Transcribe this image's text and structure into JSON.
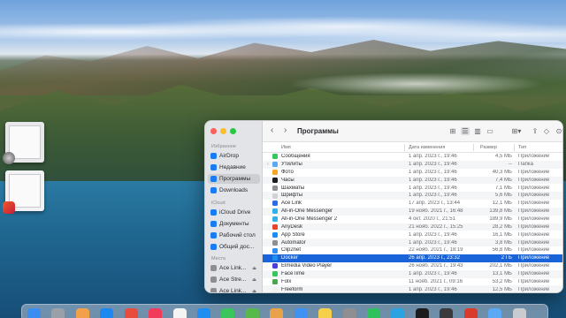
{
  "window": {
    "title": "Программы"
  },
  "sidebar": {
    "favorites_label": "Избранное",
    "favorites": [
      {
        "label": "AirDrop",
        "icon": "airdrop-icon"
      },
      {
        "label": "Недавние",
        "icon": "clock-icon"
      },
      {
        "label": "Программы",
        "icon": "applications-icon",
        "selected": true
      },
      {
        "label": "Downloads",
        "icon": "downloads-icon"
      }
    ],
    "icloud_label": "iCloud",
    "icloud": [
      {
        "label": "iCloud Drive",
        "icon": "cloud-icon"
      },
      {
        "label": "Документы",
        "icon": "document-icon"
      },
      {
        "label": "Рабочий стол",
        "icon": "desktop-icon"
      },
      {
        "label": "Общий дос...",
        "icon": "shared-folder-icon"
      }
    ],
    "locations_label": "Места",
    "locations": [
      {
        "label": "Ace Link...",
        "icon": "disk-icon"
      },
      {
        "label": "Ace Stre...",
        "icon": "disk-icon"
      },
      {
        "label": "Ace Link...",
        "icon": "disk-icon"
      }
    ]
  },
  "columns": {
    "name": "Имя",
    "date": "Дата изменения",
    "size": "Размер",
    "type": "Тип"
  },
  "rows": [
    {
      "name": "Сообщения",
      "date": "1 апр. 2023 г., 19:46",
      "size": "4,5 МБ",
      "type": "Приложение",
      "color": "#34c759"
    },
    {
      "name": "Утилиты",
      "date": "1 апр. 2023 г., 19:46",
      "size": "--",
      "type": "Папка",
      "color": "#5aa9f6",
      "folder": true
    },
    {
      "name": "Фото",
      "date": "1 апр. 2023 г., 19:46",
      "size": "40,3 МБ",
      "type": "Приложение",
      "color": "#f6a623"
    },
    {
      "name": "Часы",
      "date": "1 апр. 2023 г., 19:46",
      "size": "7,4 МБ",
      "type": "Приложение",
      "color": "#1c1c1e"
    },
    {
      "name": "Шахматы",
      "date": "1 апр. 2023 г., 19:46",
      "size": "7,1 МБ",
      "type": "Приложение",
      "color": "#8e8e93"
    },
    {
      "name": "Шрифты",
      "date": "1 апр. 2023 г., 19:46",
      "size": "5,6 МБ",
      "type": "Приложение",
      "color": "#d1d1d6"
    },
    {
      "name": "Ace Link",
      "date": "17 апр. 2023 г., 13:44",
      "size": "12,1 МБ",
      "type": "Приложение",
      "color": "#2b6de8"
    },
    {
      "name": "All-in-One Messenger",
      "date": "19 нояб. 2021 г., 16:48",
      "size": "139,8 МБ",
      "type": "Приложение",
      "color": "#2fb0e8"
    },
    {
      "name": "All-in-One Messenger 2",
      "date": "4 окт. 2020 г., 21:51",
      "size": "189,9 МБ",
      "type": "Приложение",
      "color": "#2fb0e8"
    },
    {
      "name": "AnyDesk",
      "date": "21 нояб. 2022 г., 15:25",
      "size": "28,2 МБ",
      "type": "Приложение",
      "color": "#e8412d"
    },
    {
      "name": "App Store",
      "date": "1 апр. 2023 г., 19:46",
      "size": "16,1 МБ",
      "type": "Приложение",
      "color": "#1a8cf5"
    },
    {
      "name": "Automator",
      "date": "1 апр. 2023 г., 19:46",
      "size": "3,8 МБ",
      "type": "Приложение",
      "color": "#8e8e93"
    },
    {
      "name": "Clip2net",
      "date": "22 нояб. 2021 г., 18:19",
      "size": "56,8 МБ",
      "type": "Приложение",
      "color": "#2c8ef0"
    },
    {
      "name": "Docker",
      "date": "26 апр. 2023 г., 23:32",
      "size": "2 ГБ",
      "type": "Приложение",
      "color": "#1d8ff0",
      "selected": true
    },
    {
      "name": "Elmedia Video Player",
      "date": "26 нояб. 2021 г., 19:43",
      "size": "202,1 МБ",
      "type": "Приложение",
      "color": "#4a3fd9"
    },
    {
      "name": "FaceTime",
      "date": "1 апр. 2023 г., 19:46",
      "size": "13,1 МБ",
      "type": "Приложение",
      "color": "#34c759"
    },
    {
      "name": "Folx",
      "date": "11 нояб. 2021 г., 09:16",
      "size": "53,2 МБ",
      "type": "Приложение",
      "color": "#4aa84a"
    },
    {
      "name": "Freeform",
      "date": "1 апр. 2023 г., 19:46",
      "size": "12,5 МБ",
      "type": "Приложение",
      "color": "#f0f0f0"
    }
  ],
  "dock": {
    "icons": [
      {
        "name": "finder-icon",
        "color": "#3b8df2"
      },
      {
        "name": "launchpad-icon",
        "color": "#9aa0a8"
      },
      {
        "name": "photos-icon",
        "color": "#f2a14a"
      },
      {
        "name": "safari-icon",
        "color": "#1c88f0"
      },
      {
        "name": "chrome-icon",
        "color": "#e84c3d"
      },
      {
        "name": "music-icon",
        "color": "#f33b5a"
      },
      {
        "name": "calendar-icon",
        "color": "#f4f4f4"
      },
      {
        "name": "app-store-icon",
        "color": "#1f8ef1"
      },
      {
        "name": "xcode-icon",
        "color": "#3ac55d"
      },
      {
        "name": "maps-icon",
        "color": "#56b949"
      },
      {
        "name": "sketch-icon",
        "color": "#e8a24a"
      },
      {
        "name": "mail-icon",
        "color": "#3f92f2"
      },
      {
        "name": "notes-icon",
        "color": "#f6d04d"
      },
      {
        "name": "settings-icon",
        "color": "#8e8e93"
      },
      {
        "name": "whatsapp-icon",
        "color": "#2fc15b"
      },
      {
        "name": "telegram-icon",
        "color": "#2aa3e0"
      },
      {
        "name": "terminal-icon",
        "color": "#1c1c1e"
      },
      {
        "name": "calculator-icon",
        "color": "#3a3a3c"
      },
      {
        "name": "acrobat-icon",
        "color": "#d93a2b"
      },
      {
        "name": "downloads-stack-icon",
        "color": "#5aa9f6"
      },
      {
        "name": "trash-icon",
        "color": "#c8cbd0"
      }
    ]
  }
}
